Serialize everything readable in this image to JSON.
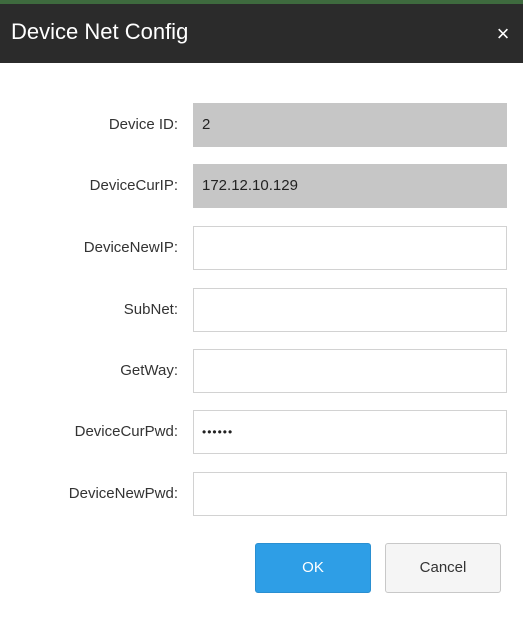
{
  "dialog": {
    "title": "Device Net Config",
    "close_symbol": "×"
  },
  "fields": [
    {
      "label": "Device ID:",
      "value": "2",
      "readonly": true
    },
    {
      "label": "DeviceCurIP:",
      "value": "172.12.10.129",
      "readonly": true
    },
    {
      "label": "DeviceNewIP:",
      "value": "",
      "readonly": false
    },
    {
      "label": "SubNet:",
      "value": "",
      "readonly": false
    },
    {
      "label": "GetWay:",
      "value": "",
      "readonly": false
    },
    {
      "label": "DeviceCurPwd:",
      "value": "••••••",
      "readonly": false
    },
    {
      "label": "DeviceNewPwd:",
      "value": "",
      "readonly": false
    }
  ],
  "buttons": {
    "ok_label": "OK",
    "cancel_label": "Cancel"
  },
  "colors": {
    "titlebar": "#2b2b2b",
    "readonly_bg": "#c6c6c6",
    "primary": "#2e9ee6"
  }
}
